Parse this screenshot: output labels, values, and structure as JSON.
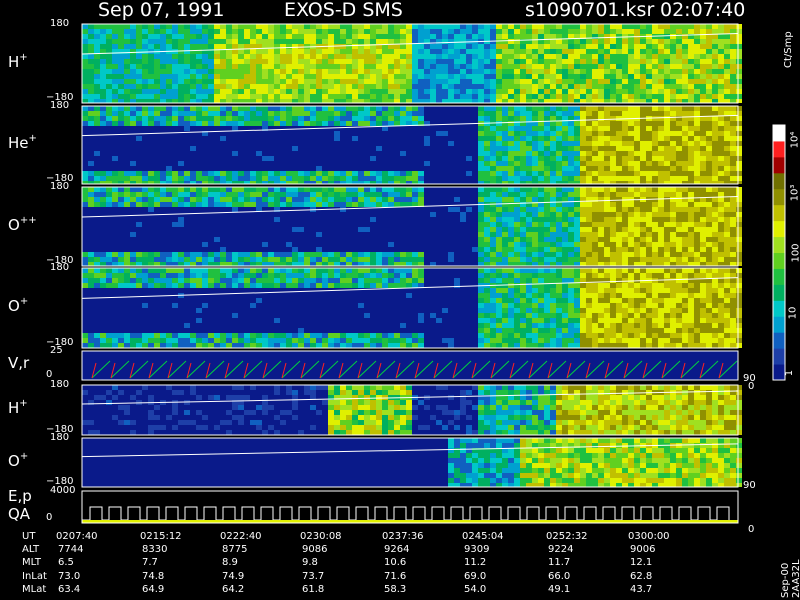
{
  "header": {
    "date": "Sep 07, 1991",
    "instrument": "EXOS-D SMS",
    "file": "s1090701.ksr",
    "time": "02:07:40"
  },
  "panels": [
    {
      "id": "h-plus",
      "name": "H",
      "charge": "+",
      "top_tick": "180",
      "bottom_tick": "−180",
      "bg": "#1e3fa8"
    },
    {
      "id": "he-plus",
      "name": "He",
      "charge": "+",
      "top_tick": "180",
      "bottom_tick": "−180",
      "bg": "#0a1a8a"
    },
    {
      "id": "o-plus-plus",
      "name": "O",
      "charge": "++",
      "top_tick": "180",
      "bottom_tick": "−180",
      "bg": "#0a1a8a"
    },
    {
      "id": "o-plus",
      "name": "O",
      "charge": "+",
      "top_tick": "180",
      "bottom_tick": "−180",
      "bg": "#0a1a8a"
    },
    {
      "id": "vr",
      "name": "V,r",
      "charge": "",
      "top_tick": "25",
      "bottom_tick": "0",
      "right_tick": "90",
      "right_bottom": "0",
      "bg": "#0a1a8a"
    },
    {
      "id": "h-plus-2",
      "name": "H",
      "charge": "+",
      "top_tick": "180",
      "bottom_tick": "−180",
      "bg": "#0a1a8a"
    },
    {
      "id": "o-plus-2",
      "name": "O",
      "charge": "+",
      "top_tick": "180",
      "bottom_tick": "−180",
      "right_tick": "90",
      "bg": "#0a1a8a"
    },
    {
      "id": "ep",
      "name": "E,p",
      "name2": "QA",
      "charge": "",
      "top_tick": "4000",
      "bottom_tick": "0",
      "right_bottom": "0",
      "bg": "#000000"
    }
  ],
  "colorbar": {
    "units": "Ct/Smp",
    "tick_labels": [
      "1",
      "10",
      "100",
      "10³",
      "10⁴"
    ],
    "colors": [
      "#0a1a8a",
      "#1e3fa8",
      "#1060c0",
      "#00a0d0",
      "#00c8c8",
      "#00b060",
      "#20c040",
      "#60d020",
      "#a0e020",
      "#e0f000",
      "#c0c000",
      "#909000",
      "#707000",
      "#a00000",
      "#ff2020",
      "#ffffff"
    ]
  },
  "footer": {
    "label": "Sep-00  2AA32L"
  },
  "chart_data": {
    "type": "heatmap",
    "title": "Sep 07, 1991   EXOS-D SMS",
    "x_time_labels": [
      "0207:40",
      "0215:12",
      "0222:40",
      "0230:08",
      "0237:36",
      "0245:04",
      "0252:32",
      "0300:00"
    ],
    "ephemeris": [
      {
        "label": "UT",
        "values": [
          "0207:40",
          "0215:12",
          "0222:40",
          "0230:08",
          "0237:36",
          "0245:04",
          "0252:32",
          "0300:00"
        ]
      },
      {
        "label": "ALT",
        "values": [
          "7744",
          "8330",
          "8775",
          "9086",
          "9264",
          "9309",
          "9224",
          "9006"
        ]
      },
      {
        "label": "MLT",
        "values": [
          "6.5",
          "7.7",
          "8.9",
          "9.8",
          "10.6",
          "11.2",
          "11.7",
          "12.1"
        ]
      },
      {
        "label": "InLat",
        "values": [
          "73.0",
          "74.8",
          "74.9",
          "73.7",
          "71.6",
          "69.0",
          "66.0",
          "62.8"
        ]
      },
      {
        "label": "MLat",
        "values": [
          "63.4",
          "64.9",
          "64.2",
          "61.8",
          "58.3",
          "54.0",
          "49.1",
          "43.7"
        ]
      }
    ]
  }
}
